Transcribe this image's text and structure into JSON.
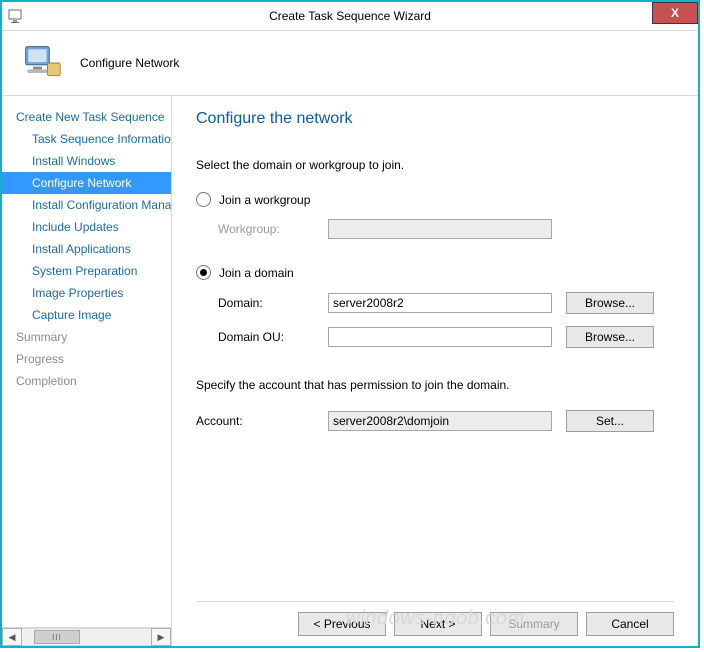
{
  "window": {
    "title": "Create Task Sequence Wizard",
    "close_label": "X"
  },
  "banner": {
    "title": "Configure Network"
  },
  "sidebar": {
    "items": [
      {
        "label": "Create New Task Sequence",
        "level": 0,
        "muted": false,
        "selected": false
      },
      {
        "label": "Task Sequence Information",
        "level": 1,
        "muted": false,
        "selected": false
      },
      {
        "label": "Install Windows",
        "level": 1,
        "muted": false,
        "selected": false
      },
      {
        "label": "Configure Network",
        "level": 1,
        "muted": false,
        "selected": true
      },
      {
        "label": "Install Configuration Manager",
        "level": 1,
        "muted": false,
        "selected": false
      },
      {
        "label": "Include Updates",
        "level": 1,
        "muted": false,
        "selected": false
      },
      {
        "label": "Install Applications",
        "level": 1,
        "muted": false,
        "selected": false
      },
      {
        "label": "System Preparation",
        "level": 1,
        "muted": false,
        "selected": false
      },
      {
        "label": "Image Properties",
        "level": 1,
        "muted": false,
        "selected": false
      },
      {
        "label": "Capture Image",
        "level": 1,
        "muted": false,
        "selected": false
      },
      {
        "label": "Summary",
        "level": 0,
        "muted": true,
        "selected": false
      },
      {
        "label": "Progress",
        "level": 0,
        "muted": true,
        "selected": false
      },
      {
        "label": "Completion",
        "level": 0,
        "muted": true,
        "selected": false
      }
    ],
    "scroll_thumb_glyph": "III"
  },
  "page": {
    "heading": "Configure the network",
    "intro": "Select the domain or workgroup to join.",
    "workgroup": {
      "radio_label": "Join a workgroup",
      "field_label": "Workgroup:",
      "value": "",
      "selected": false
    },
    "domain": {
      "radio_label": "Join a domain",
      "selected": true,
      "domain_label": "Domain:",
      "domain_value": "server2008r2",
      "ou_label": "Domain OU:",
      "ou_value": "",
      "browse_label": "Browse..."
    },
    "account": {
      "intro": "Specify the account that has permission to join the domain.",
      "label": "Account:",
      "value": "server2008r2\\domjoin",
      "set_label": "Set..."
    }
  },
  "footer": {
    "previous": "< Previous",
    "next": "Next >",
    "summary": "Summary",
    "cancel": "Cancel"
  },
  "watermark": "windows-noob.com"
}
